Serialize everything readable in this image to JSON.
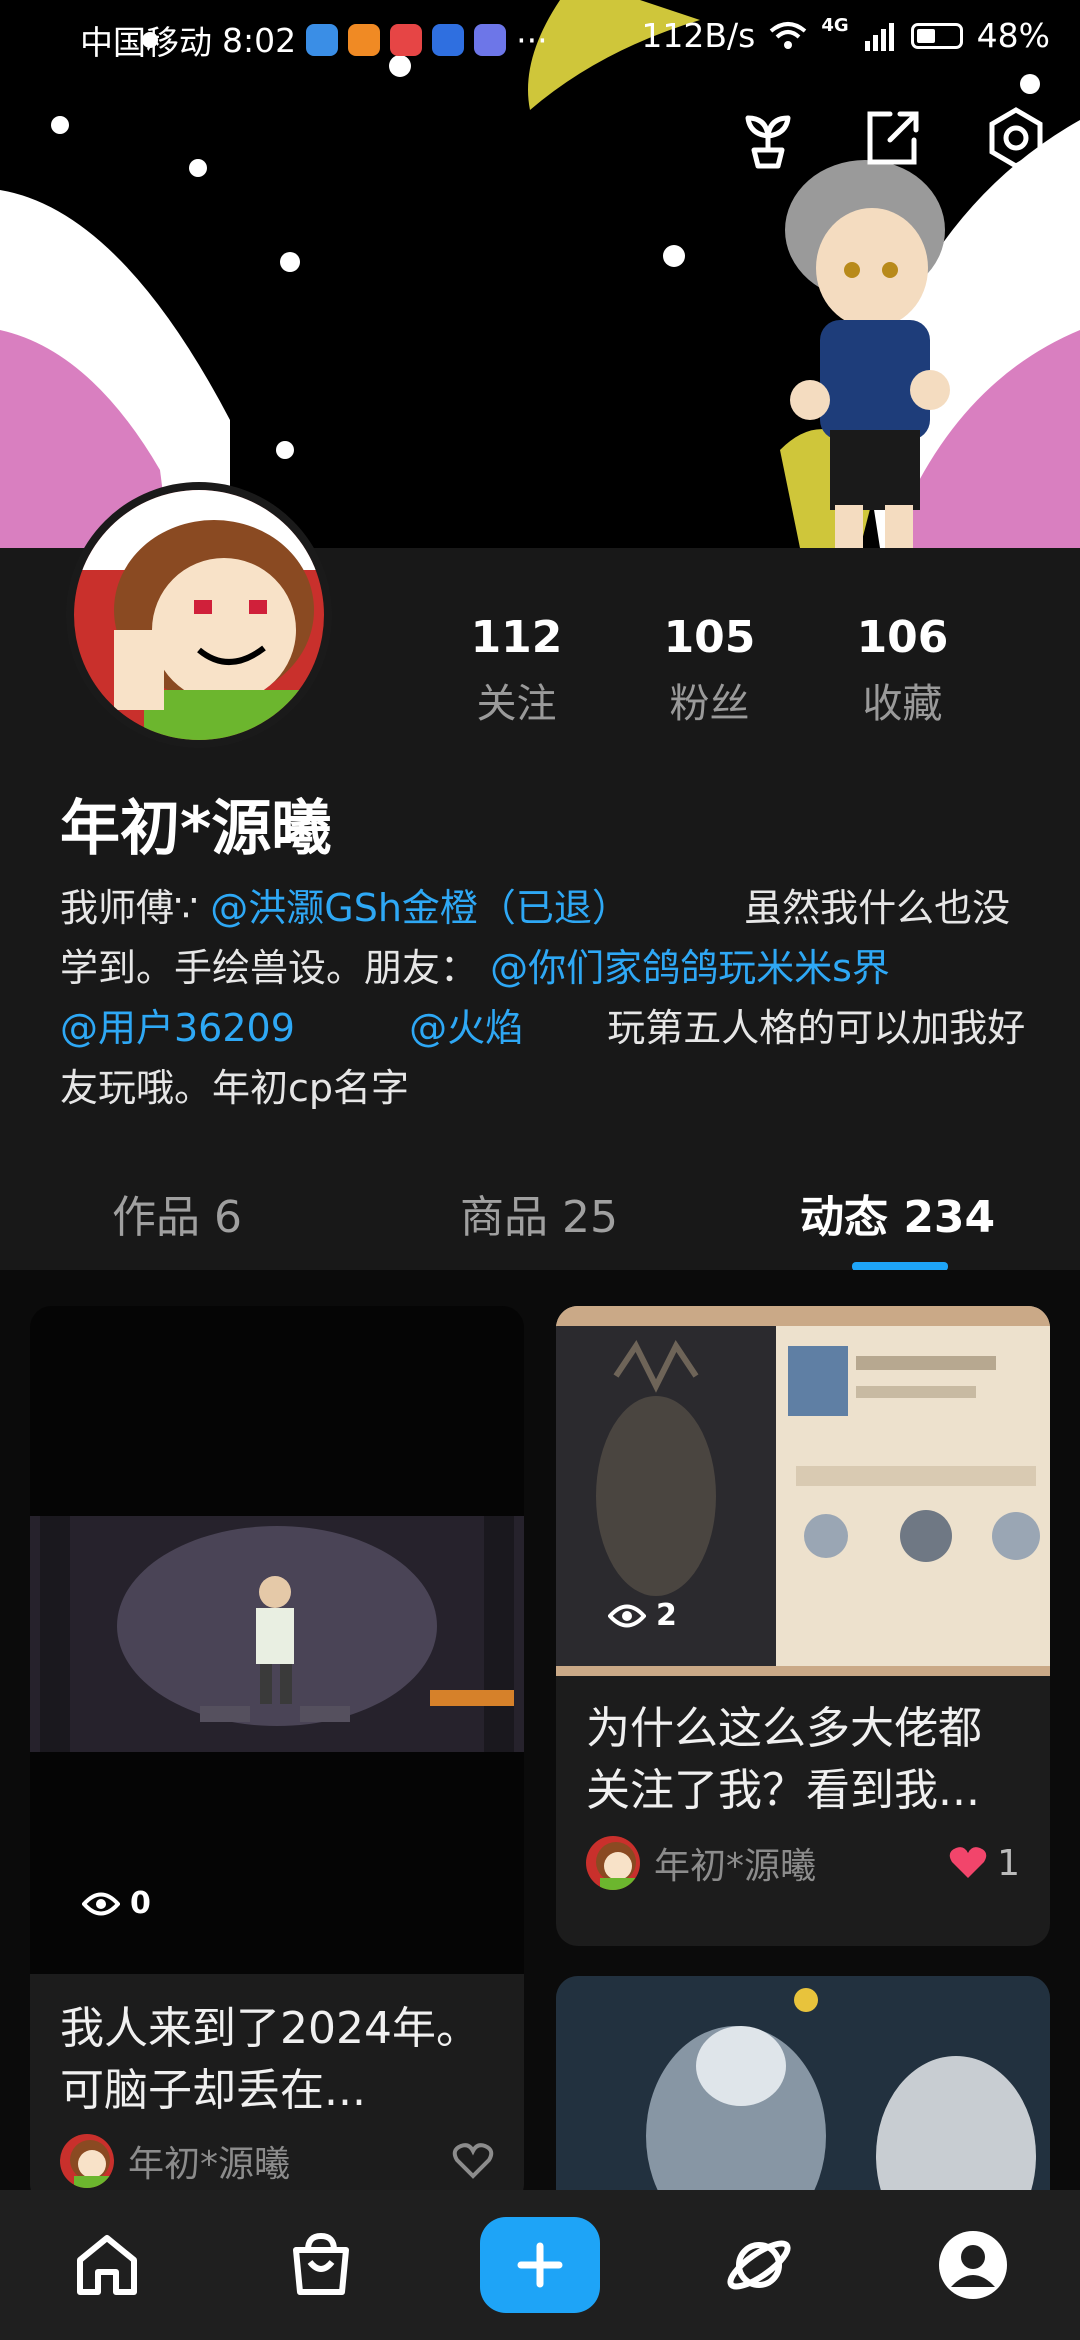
{
  "status": {
    "carrier": "中国移动",
    "time": "8:02",
    "network_speed": "112B/s",
    "signal": "4G",
    "battery": "48%"
  },
  "profile": {
    "stats": [
      {
        "num": "112",
        "label": "关注"
      },
      {
        "num": "105",
        "label": "粉丝"
      },
      {
        "num": "106",
        "label": "收藏"
      }
    ],
    "username": "年初*源曦",
    "bio": {
      "prefix": "我师傅∵",
      "mention1": "@洪灏GSh金橙（已退）",
      "mid": "虽然我什么也没学到。手绘兽设。朋友：",
      "mention2": "@你们家鸽鸽玩米米s界",
      "mention3": "@用户36209",
      "mention4": "@火焰",
      "suffix": "玩第五人格的可以加我好友玩哦。年初cp名字"
    }
  },
  "tabs": [
    {
      "label": "作品 6"
    },
    {
      "label": "商品 25"
    },
    {
      "label": "动态 234"
    }
  ],
  "cards": [
    {
      "views": "0",
      "title": "我人来到了2024年。可脑子却丢在...",
      "author": "年初*源曦",
      "likes": ""
    },
    {
      "views": "2",
      "title": "为什么这么多大佬都关注了我？看到我...",
      "author": "年初*源曦",
      "likes": "1"
    }
  ]
}
